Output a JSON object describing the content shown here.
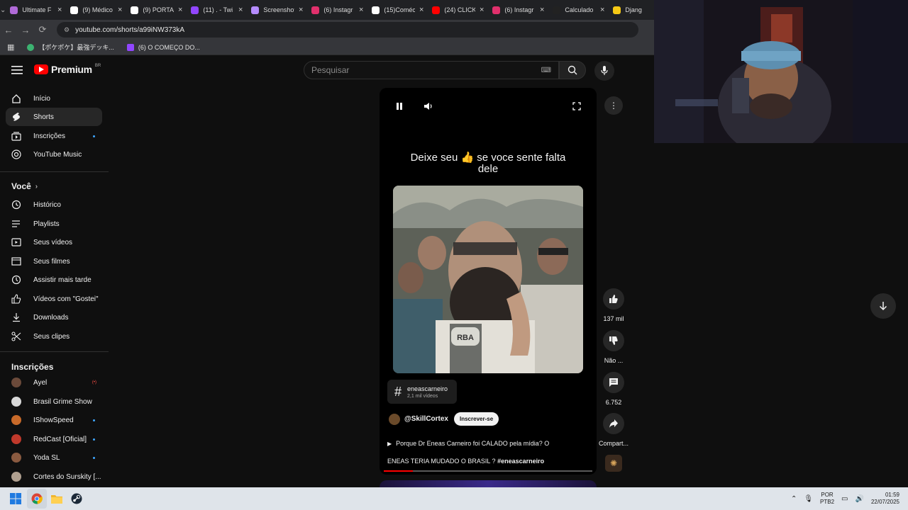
{
  "browser": {
    "tabs": [
      {
        "label": "Ultimate F",
        "color": "#b06ad8"
      },
      {
        "label": "(9) Médico",
        "color": "#ffffff"
      },
      {
        "label": "(9) PORTAL",
        "color": "#ffffff"
      },
      {
        "label": "(11) . - Twi",
        "color": "#9146ff"
      },
      {
        "label": "Screenshot",
        "color": "#b58cff"
      },
      {
        "label": "(6) Instagr",
        "color": "#e1306c"
      },
      {
        "label": "(15)Coméc",
        "color": "#ffffff"
      },
      {
        "label": "(24) CLICK",
        "color": "#ff0000"
      },
      {
        "label": "(6) Instagr",
        "color": "#e1306c"
      },
      {
        "label": "Calculado",
        "color": "#222222"
      },
      {
        "label": "Djang",
        "color": "#f6c915"
      }
    ],
    "url": "youtube.com/shorts/a99iNW373kA",
    "bookmarks": [
      "【ポケポケ】最強デッキ...",
      "(6) O COMEÇO DO..."
    ]
  },
  "header": {
    "brand": "Premium",
    "region": "BR",
    "search_placeholder": "Pesquisar"
  },
  "sidebar": {
    "main": [
      {
        "label": "Início",
        "icon": "home-icon"
      },
      {
        "label": "Shorts",
        "icon": "shorts-icon"
      },
      {
        "label": "Inscrições",
        "icon": "subscriptions-icon"
      },
      {
        "label": "YouTube Music",
        "icon": "music-icon"
      }
    ],
    "you_heading": "Você",
    "you": [
      {
        "label": "Histórico",
        "icon": "history-icon"
      },
      {
        "label": "Playlists",
        "icon": "playlists-icon"
      },
      {
        "label": "Seus vídeos",
        "icon": "your-videos-icon"
      },
      {
        "label": "Seus filmes",
        "icon": "movies-icon"
      },
      {
        "label": "Assistir mais tarde",
        "icon": "watch-later-icon"
      },
      {
        "label": "Vídeos com \"Gostei\"",
        "icon": "liked-icon"
      },
      {
        "label": "Downloads",
        "icon": "downloads-icon"
      },
      {
        "label": "Seus clipes",
        "icon": "clips-icon"
      }
    ],
    "subs_heading": "Inscrições",
    "subs": [
      {
        "label": "Ayel",
        "color": "#6b4a3a",
        "live": "(•)"
      },
      {
        "label": "Brasil Grime Show",
        "color": "#d8d8d8",
        "live": ""
      },
      {
        "label": "IShowSpeed",
        "color": "#c86a2a",
        "live": ""
      },
      {
        "label": "RedCast [Oficial]",
        "color": "#c0392b",
        "live": ""
      },
      {
        "label": "Yoda SL",
        "color": "#8a5a40",
        "live": ""
      },
      {
        "label": "Cortes do Surskity [...",
        "color": "#b0a090",
        "live": ""
      }
    ]
  },
  "short": {
    "caption": "Deixe seu 👍 se voce sente falta dele",
    "hashtag": "eneascarneiro",
    "hashtag_count": "2,1 mil vídeos",
    "channel": "@SkillCortex",
    "subscribe": "Inscrever-se",
    "title_line1": "Porque Dr Eneas Carneiro foi CALADO pela mídia? O",
    "title_line2": "ENEAS TERIA MUDADO O BRASIL ?",
    "title_tag": "#eneascarneiro",
    "progress": 0.14,
    "video_logo": "RBA"
  },
  "actions": {
    "likes": "137 mil",
    "dislike": "Não ...",
    "comments": "6.752",
    "share": "Compart..."
  },
  "taskbar": {
    "lang1": "POR",
    "lang2": "PTB2",
    "time": "01:59",
    "date": "22/07/2025"
  }
}
